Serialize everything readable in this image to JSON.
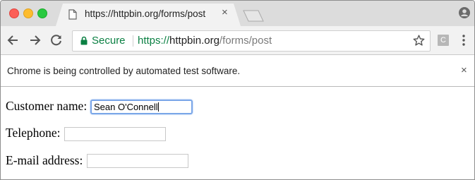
{
  "tab": {
    "title": "https://httpbin.org/forms/post",
    "close_glyph": "×"
  },
  "toolbar": {
    "secure_label": "Secure",
    "url_scheme": "https://",
    "url_host": "httpbin.org",
    "url_path": "/forms/post",
    "extension_letter": "C"
  },
  "infobar": {
    "message": "Chrome is being controlled by automated test software.",
    "close_glyph": "×"
  },
  "form": {
    "customer_name_label": "Customer name:",
    "customer_name_value": "Sean O'Connell",
    "telephone_label": "Telephone:",
    "telephone_value": "",
    "email_label": "E-mail address:",
    "email_value": ""
  },
  "colors": {
    "secure_green": "#0b8043",
    "focus_ring": "#7aa6e8"
  },
  "icons": [
    "document-icon",
    "close-icon",
    "new-tab-icon",
    "profile-icon",
    "back-icon",
    "forward-icon",
    "reload-icon",
    "lock-icon",
    "star-icon",
    "extension-icon",
    "menu-icon"
  ]
}
